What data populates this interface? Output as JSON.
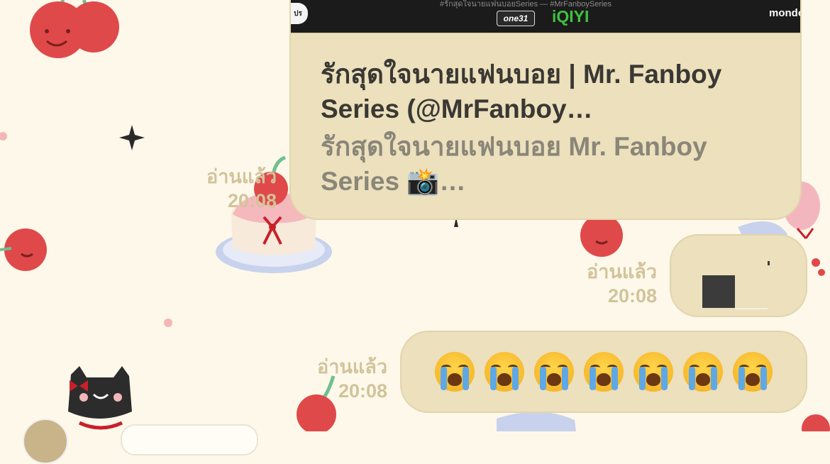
{
  "chat": {
    "link_preview": {
      "thumbnail": {
        "top_text": "#รักสุดใจนายแฟนบอยSeries — #MrFanboySeries",
        "logo_left": "ปร",
        "channel_logo": "one31",
        "streaming_logo": "iQIYI",
        "producer_logo": "mondo"
      },
      "title": "รักสุดใจนายแฟนบอย | Mr. Fanboy Series (@MrFanboy…",
      "description": "รักสุดใจนายแฟนบอย Mr. Fanboy Series 📸…",
      "read_status": "อ่านแล้ว",
      "time": "20:08"
    },
    "photo_message": {
      "read_status": "อ่านแล้ว",
      "time": "20:08"
    },
    "emoji_message": {
      "emojis": [
        "😭",
        "😭",
        "😭",
        "😭",
        "😭",
        "😭",
        "😭"
      ],
      "read_status": "อ่านแล้ว",
      "time": "20:08"
    }
  },
  "wallpaper": {
    "theme": "cherry-cake-cat",
    "background_color": "#fdf8ea",
    "bubble_color": "#ece0bd",
    "status_color": "#d2c39a"
  },
  "emoji_icon": "loudly-crying-face-icon"
}
